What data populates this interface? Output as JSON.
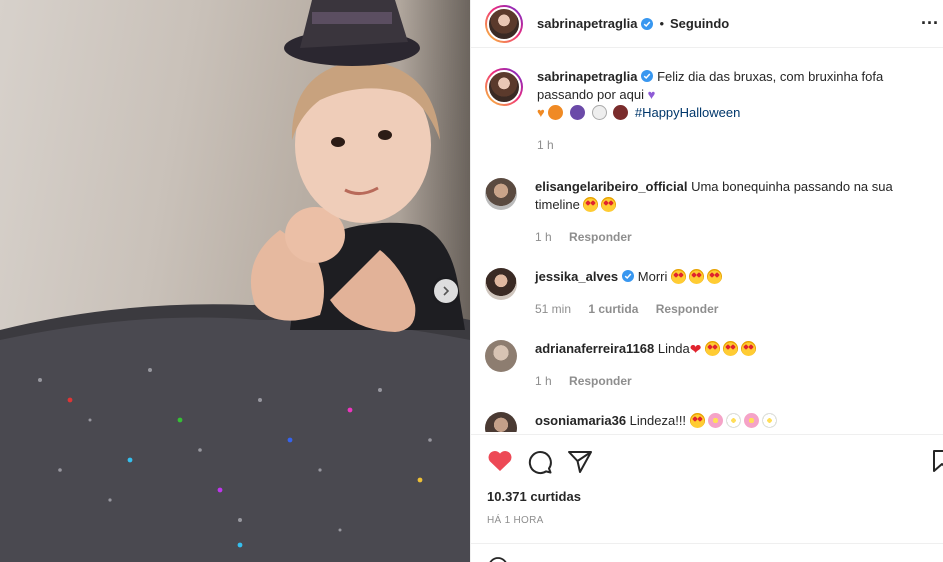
{
  "post": {
    "author": "sabrinapetraglia",
    "follow_status": "Seguindo",
    "separator": "•",
    "more_label": "...",
    "caption_text": "Feliz dia das bruxas, com bruxinha fofa passando por aqui",
    "caption_hashtag": "#HappyHalloween",
    "caption_time": "1 h",
    "likes_text": "10.371 curtidas",
    "posted_ago": "HÁ 1 HORA"
  },
  "comments": [
    {
      "user": "elisangelaribeiro_official",
      "text": "Uma bonequinha passando na sua timeline",
      "time": "1 h",
      "reply": "Responder"
    },
    {
      "user": "jessika_alves",
      "text": "Morri",
      "time": "51 min",
      "likes": "1 curtida",
      "reply": "Responder"
    },
    {
      "user": "adrianaferreira1168",
      "text": "Linda",
      "time": "1 h",
      "reply": "Responder"
    },
    {
      "user": "osoniamaria36",
      "text": "Lindeza!!!"
    }
  ],
  "colors": {
    "like_red": "#ed4956",
    "link_blue": "#00376b",
    "verified_blue": "#3897f0",
    "muted": "#8e8e8e"
  },
  "icons": [
    "more-icon",
    "verified-icon",
    "heart-icon",
    "comment-icon",
    "share-icon",
    "save-icon",
    "next-arrow-icon"
  ]
}
